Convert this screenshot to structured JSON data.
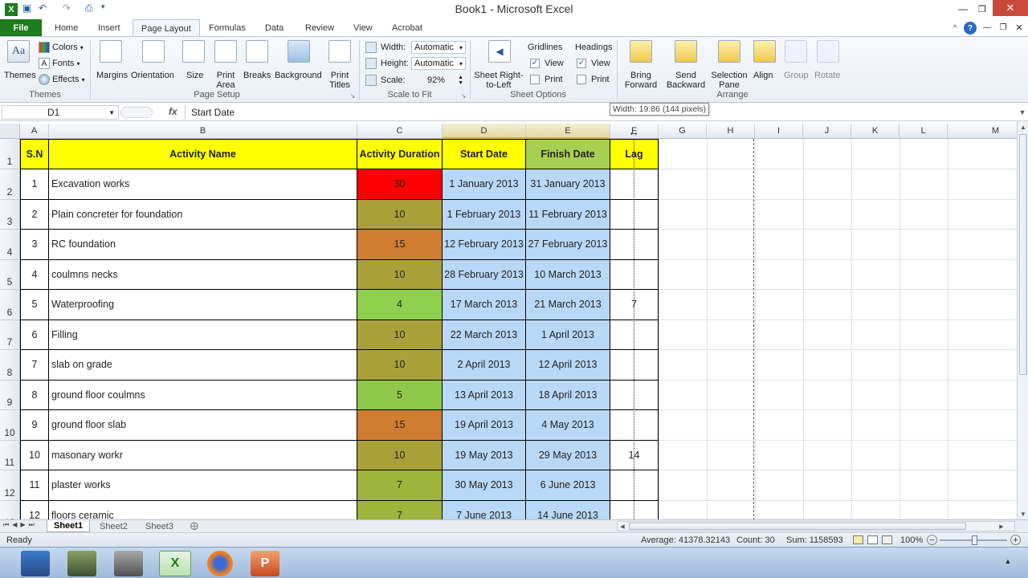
{
  "window": {
    "title": "Book1  -  Microsoft Excel"
  },
  "tabs": [
    "File",
    "Home",
    "Insert",
    "Page Layout",
    "Formulas",
    "Data",
    "Review",
    "View",
    "Acrobat"
  ],
  "ribbon": {
    "themes": {
      "themes_label": "Themes",
      "colors": "Colors",
      "fonts": "Fonts",
      "effects": "Effects",
      "group": "Themes"
    },
    "page_setup": {
      "margins": "Margins",
      "orientation": "Orientation",
      "size": "Size",
      "print_area": "Print Area",
      "breaks": "Breaks",
      "background": "Background",
      "print_titles": "Print Titles",
      "group": "Page Setup"
    },
    "scale": {
      "width_label": "Width:",
      "width_value": "Automatic",
      "height_label": "Height:",
      "height_value": "Automatic",
      "scale_label": "Scale:",
      "scale_value": "92%",
      "group": "Scale to Fit"
    },
    "sheet_dir": {
      "label": "Sheet Right-to-Left"
    },
    "sheet_options": {
      "gridlines": "Gridlines",
      "headings": "Headings",
      "view": "View",
      "print": "Print",
      "group": "Sheet Options"
    },
    "arrange": {
      "bring_forward": "Bring Forward",
      "send_backward": "Send Backward",
      "selection_pane": "Selection Pane",
      "align": "Align",
      "group_btn": "Group",
      "rotate": "Rotate",
      "group": "Arrange"
    }
  },
  "formula_bar": {
    "name_box": "D1",
    "fx": "fx",
    "content": "Start Date",
    "tooltip": "Width: 19.86 (144 pixels)"
  },
  "columns": [
    "A",
    "B",
    "C",
    "D",
    "E",
    "F",
    "G",
    "H",
    "I",
    "J",
    "K",
    "L",
    "M"
  ],
  "table": {
    "headers": [
      "S.N",
      "Activity Name",
      "Activity Duration",
      "Start Date",
      "Finish Date",
      "Lag"
    ],
    "rows": [
      {
        "sn": "1",
        "name": "Excavation works",
        "duration": "30",
        "start": "1 January 2013",
        "finish": "31 January 2013",
        "lag": "",
        "dur_color": "#ff0000"
      },
      {
        "sn": "2",
        "name": "Plain concreter for foundation",
        "duration": "10",
        "start": "1 February 2013",
        "finish": "11 February 2013",
        "lag": "",
        "dur_color": "#aaa03a"
      },
      {
        "sn": "3",
        "name": "RC foundation",
        "duration": "15",
        "start": "12 February 2013",
        "finish": "27 February 2013",
        "lag": "",
        "dur_color": "#cf7d30"
      },
      {
        "sn": "4",
        "name": "coulmns necks",
        "duration": "10",
        "start": "28 February 2013",
        "finish": "10 March 2013",
        "lag": "",
        "dur_color": "#aaa03a"
      },
      {
        "sn": "5",
        "name": "Waterproofing",
        "duration": "4",
        "start": "17 March 2013",
        "finish": "21 March 2013",
        "lag": "7",
        "dur_color": "#8ed04e"
      },
      {
        "sn": "6",
        "name": "Filling",
        "duration": "10",
        "start": "22 March 2013",
        "finish": "1 April 2013",
        "lag": "",
        "dur_color": "#aaa03a"
      },
      {
        "sn": "7",
        "name": "slab on grade",
        "duration": "10",
        "start": "2 April 2013",
        "finish": "12 April 2013",
        "lag": "",
        "dur_color": "#aaa03a"
      },
      {
        "sn": "8",
        "name": "ground floor coulmns",
        "duration": "5",
        "start": "13 April 2013",
        "finish": "18 April 2013",
        "lag": "",
        "dur_color": "#8ec84a"
      },
      {
        "sn": "9",
        "name": "ground floor slab",
        "duration": "15",
        "start": "19 April 2013",
        "finish": "4 May 2013",
        "lag": "",
        "dur_color": "#cf7d30"
      },
      {
        "sn": "10",
        "name": "masonary workr",
        "duration": "10",
        "start": "19 May 2013",
        "finish": "29 May 2013",
        "lag": "14",
        "dur_color": "#aaa03a"
      },
      {
        "sn": "11",
        "name": "plaster works",
        "duration": "7",
        "start": "30 May 2013",
        "finish": "6 June 2013",
        "lag": "",
        "dur_color": "#9eb43a"
      },
      {
        "sn": "12",
        "name": "floors ceramic",
        "duration": "7",
        "start": "7 June 2013",
        "finish": "14 June 2013",
        "lag": "",
        "dur_color": "#9eb43a"
      }
    ]
  },
  "sheets": [
    "Sheet1",
    "Sheet2",
    "Sheet3"
  ],
  "status": {
    "ready": "Ready",
    "average": "Average: 41378.32143",
    "count": "Count: 30",
    "sum": "Sum: 1158593",
    "zoom": "100%"
  },
  "colors": {
    "header_yellow": "#ffff00",
    "date_blue": "#b8d8f8",
    "finish_header_green": "#a8d050",
    "start_header_yellow": "#ffff00"
  }
}
